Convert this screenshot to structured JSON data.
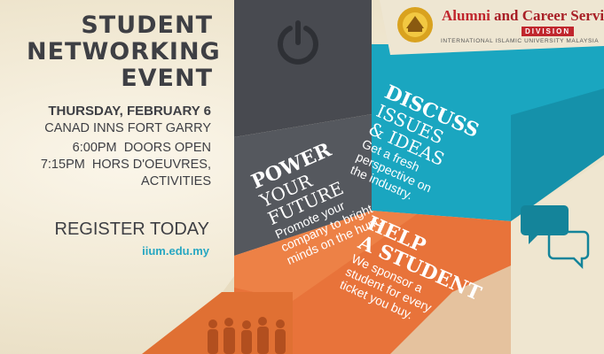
{
  "event": {
    "headline": [
      "STUDENT",
      "NETWORKING",
      "EVENT"
    ],
    "date": "THURSDAY, FEBRUARY 6",
    "venue": "CANAD INNS FORT GARRY",
    "schedule": [
      {
        "time": "6:00PM",
        "activity": "DOORS OPEN"
      },
      {
        "time": "7:15PM",
        "activity": "HORS D'OEUVRES,"
      }
    ],
    "schedule_extra": "ACTIVITIES",
    "register": "REGISTER TODAY",
    "url": "iium.edu.my"
  },
  "logo": {
    "title_part1": "Alumni",
    "title_part2": " and Career Services",
    "division": "DIVISION",
    "university": "INTERNATIONAL ISLAMIC UNIVERSITY MALAYSIA"
  },
  "panels": {
    "power": {
      "title": "POWER",
      "subtitle": [
        "YOUR",
        "FUTURE"
      ],
      "body": [
        "Promote your",
        "company to bright",
        "minds on the hunt."
      ]
    },
    "discuss": {
      "title": "DISCUSS",
      "subtitle": [
        "ISSUES",
        "& IDEAS"
      ],
      "body": [
        "Get a fresh",
        "perspective on",
        "the industry."
      ]
    },
    "help": {
      "title": [
        "HELP",
        "A STUDENT"
      ],
      "body": [
        "We sponsor a",
        "student for every",
        "ticket you buy."
      ]
    }
  },
  "icons": [
    "power-icon",
    "chat-bubbles-icon",
    "people-silhouette-icon",
    "university-crest-icon"
  ],
  "colors": {
    "dark": "#4a4c52",
    "teal": "#1aa6c0",
    "orange": "#e8733a",
    "text": "#3e3f44",
    "link": "#27a7c2",
    "brand_red": "#c0262d"
  }
}
